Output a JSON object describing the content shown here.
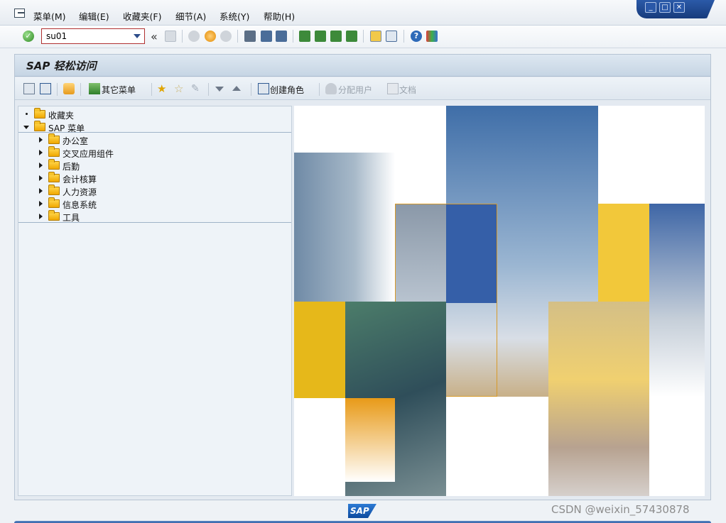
{
  "menubar": {
    "items": [
      {
        "label": "菜单(M)"
      },
      {
        "label": "编辑(E)"
      },
      {
        "label": "收藏夹(F)"
      },
      {
        "label": "细节(A)"
      },
      {
        "label": "系统(Y)"
      },
      {
        "label": "帮助(H)"
      }
    ],
    "window_controls": [
      "_",
      "□",
      "✕"
    ]
  },
  "toolbar": {
    "command_field_value": "su01",
    "back_glyph": "«"
  },
  "page": {
    "title": "SAP 轻松访问"
  },
  "app_toolbar": {
    "other_menu_label": "其它菜单",
    "create_role_label": "创建角色",
    "assign_users_label": "分配用户",
    "documentation_label": "文档"
  },
  "tree": {
    "favorites_label": "收藏夹",
    "sap_menu_label": "SAP 菜单",
    "items": [
      {
        "label": "办公室"
      },
      {
        "label": "交叉应用组件"
      },
      {
        "label": "后勤"
      },
      {
        "label": "会计核算"
      },
      {
        "label": "人力资源"
      },
      {
        "label": "信息系统"
      },
      {
        "label": "工具"
      }
    ]
  },
  "footer": {
    "logo_text": "SAP",
    "watermark": "CSDN @weixin_57430878"
  },
  "colors": {
    "accent_blue": "#2b5aa0",
    "folder_yellow": "#f0a800",
    "panel_bg": "#e4eaf1"
  }
}
